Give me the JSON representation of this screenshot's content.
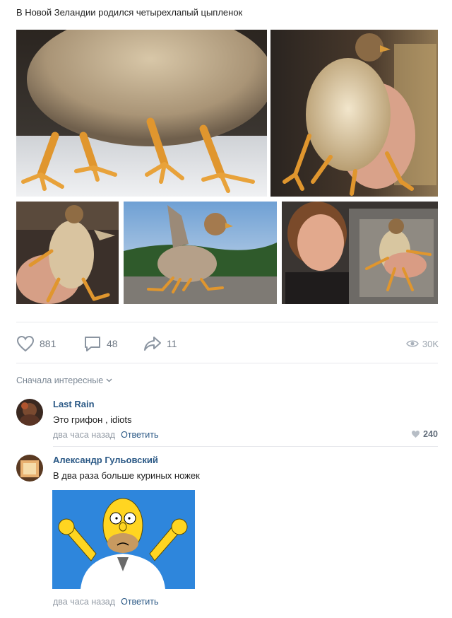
{
  "post": {
    "text": "В Новой Зеландии родился четырехлапый цыпленок"
  },
  "actions": {
    "likes": "881",
    "comments": "48",
    "shares": "11",
    "views": "30K"
  },
  "comments_section": {
    "sort_label": "Сначала интересные"
  },
  "comments": [
    {
      "author": "Last Rain",
      "text": "Это грифон , idiots",
      "time": "два часа назад",
      "reply_label": "Ответить",
      "likes": "240"
    },
    {
      "author": "Александр Гульовский",
      "text": "В два раза больше куриных ножек",
      "time": "два часа назад",
      "reply_label": "Ответить"
    }
  ],
  "colors": {
    "link": "#2a5885",
    "muted": "#939ba5",
    "action": "#6f7985",
    "divider": "#e7e8ec"
  }
}
